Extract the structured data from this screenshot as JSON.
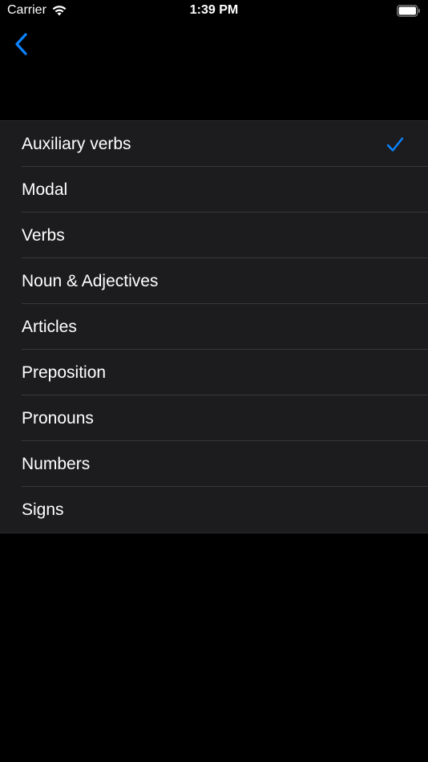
{
  "status_bar": {
    "carrier": "Carrier",
    "time": "1:39 PM"
  },
  "nav": {
    "back_icon": "chevron-left-icon"
  },
  "list": {
    "items": [
      {
        "label": "Auxiliary verbs",
        "selected": true
      },
      {
        "label": "Modal",
        "selected": false
      },
      {
        "label": "Verbs",
        "selected": false
      },
      {
        "label": "Noun & Adjectives",
        "selected": false
      },
      {
        "label": "Articles",
        "selected": false
      },
      {
        "label": "Preposition",
        "selected": false
      },
      {
        "label": "Pronouns",
        "selected": false
      },
      {
        "label": "Numbers",
        "selected": false
      },
      {
        "label": "Signs",
        "selected": false
      }
    ]
  },
  "colors": {
    "background": "#000000",
    "cell": "#1c1c1e",
    "separator": "#38383a",
    "accent": "#0a84ff",
    "text": "#ffffff"
  }
}
